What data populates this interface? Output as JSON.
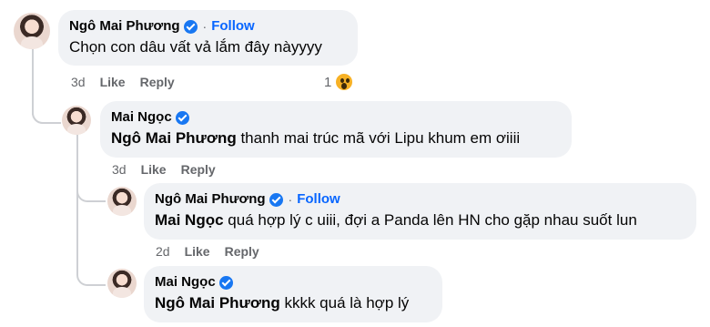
{
  "comments": [
    {
      "author": "Ngô Mai Phương",
      "follow": "Follow",
      "dot": "·",
      "mention": "",
      "text": "Chọn con dâu vất vả lắm đây nàyyyy",
      "time": "3d",
      "like": "Like",
      "reply": "Reply",
      "reaction_count": "1"
    },
    {
      "author": "Mai Ngọc",
      "mention": "Ngô Mai Phương",
      "text": "thanh mai trúc mã với Lipu khum em ơiiii",
      "time": "3d",
      "like": "Like",
      "reply": "Reply"
    },
    {
      "author": "Ngô Mai Phương",
      "follow": "Follow",
      "dot": "·",
      "mention": "Mai Ngọc",
      "text": "quá hợp lý c uiii, đợi a Panda lên HN cho gặp nhau suốt lun",
      "time": "2d",
      "like": "Like",
      "reply": "Reply"
    },
    {
      "author": "Mai Ngọc",
      "mention": "Ngô Mai Phương",
      "text": "kkkk quá là hợp lý"
    }
  ],
  "icons": {
    "verified": "verified-badge-icon",
    "reaction": "wow-reaction-icon"
  },
  "colors": {
    "bubble": "#f0f2f5",
    "link": "#0866ff",
    "verified": "#1877f2",
    "meta": "#65676b"
  }
}
